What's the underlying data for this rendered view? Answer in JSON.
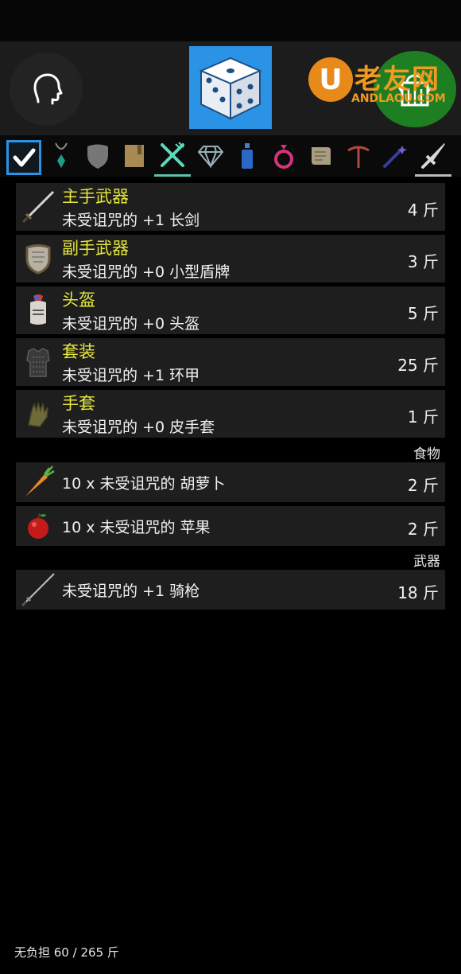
{
  "header": {
    "watermark_cn": "老友网",
    "watermark_en": "ANDLAOU.COM",
    "watermark_letter": "U",
    "left_icon": "head-profile-icon",
    "center_icon": "dice-icon",
    "right_icon": "backpack-icon",
    "accent_blue": "#2a93e6",
    "accent_green": "#1e7f22"
  },
  "tabs": [
    {
      "icon": "checkbox-icon"
    },
    {
      "icon": "amulet-icon"
    },
    {
      "icon": "shield-icon"
    },
    {
      "icon": "book-icon"
    },
    {
      "icon": "fork-knife-icon"
    },
    {
      "icon": "gem-icon"
    },
    {
      "icon": "potion-icon"
    },
    {
      "icon": "ring-icon"
    },
    {
      "icon": "scroll-icon"
    },
    {
      "icon": "pickaxe-icon"
    },
    {
      "icon": "wand-icon"
    },
    {
      "icon": "sword-icon"
    }
  ],
  "equipped": [
    {
      "category": "主手武器",
      "name": "未受诅咒的 +1 长剑",
      "weight": "4 斤",
      "icon": "longsword-icon"
    },
    {
      "category": "副手武器",
      "name": "未受诅咒的 +0 小型盾牌",
      "weight": "3 斤",
      "icon": "small-shield-icon"
    },
    {
      "category": "头盔",
      "name": "未受诅咒的 +0 头盔",
      "weight": "5 斤",
      "icon": "helmet-icon"
    },
    {
      "category": "套装",
      "name": "未受诅咒的 +1 环甲",
      "weight": "25 斤",
      "icon": "ring-mail-icon"
    },
    {
      "category": "手套",
      "name": "未受诅咒的 +0 皮手套",
      "weight": "1 斤",
      "icon": "leather-glove-icon"
    }
  ],
  "sections": [
    {
      "label": "食物",
      "items": [
        {
          "name": "10 x 未受诅咒的 胡萝卜",
          "weight": "2 斤",
          "icon": "carrot-icon"
        },
        {
          "name": "10 x 未受诅咒的 苹果",
          "weight": "2 斤",
          "icon": "apple-icon"
        }
      ]
    },
    {
      "label": "武器",
      "items": [
        {
          "name": "未受诅咒的 +1 骑枪",
          "weight": "18 斤",
          "icon": "lance-icon"
        }
      ]
    }
  ],
  "footer": {
    "encumbrance": "无负担 60 / 265 斤"
  }
}
